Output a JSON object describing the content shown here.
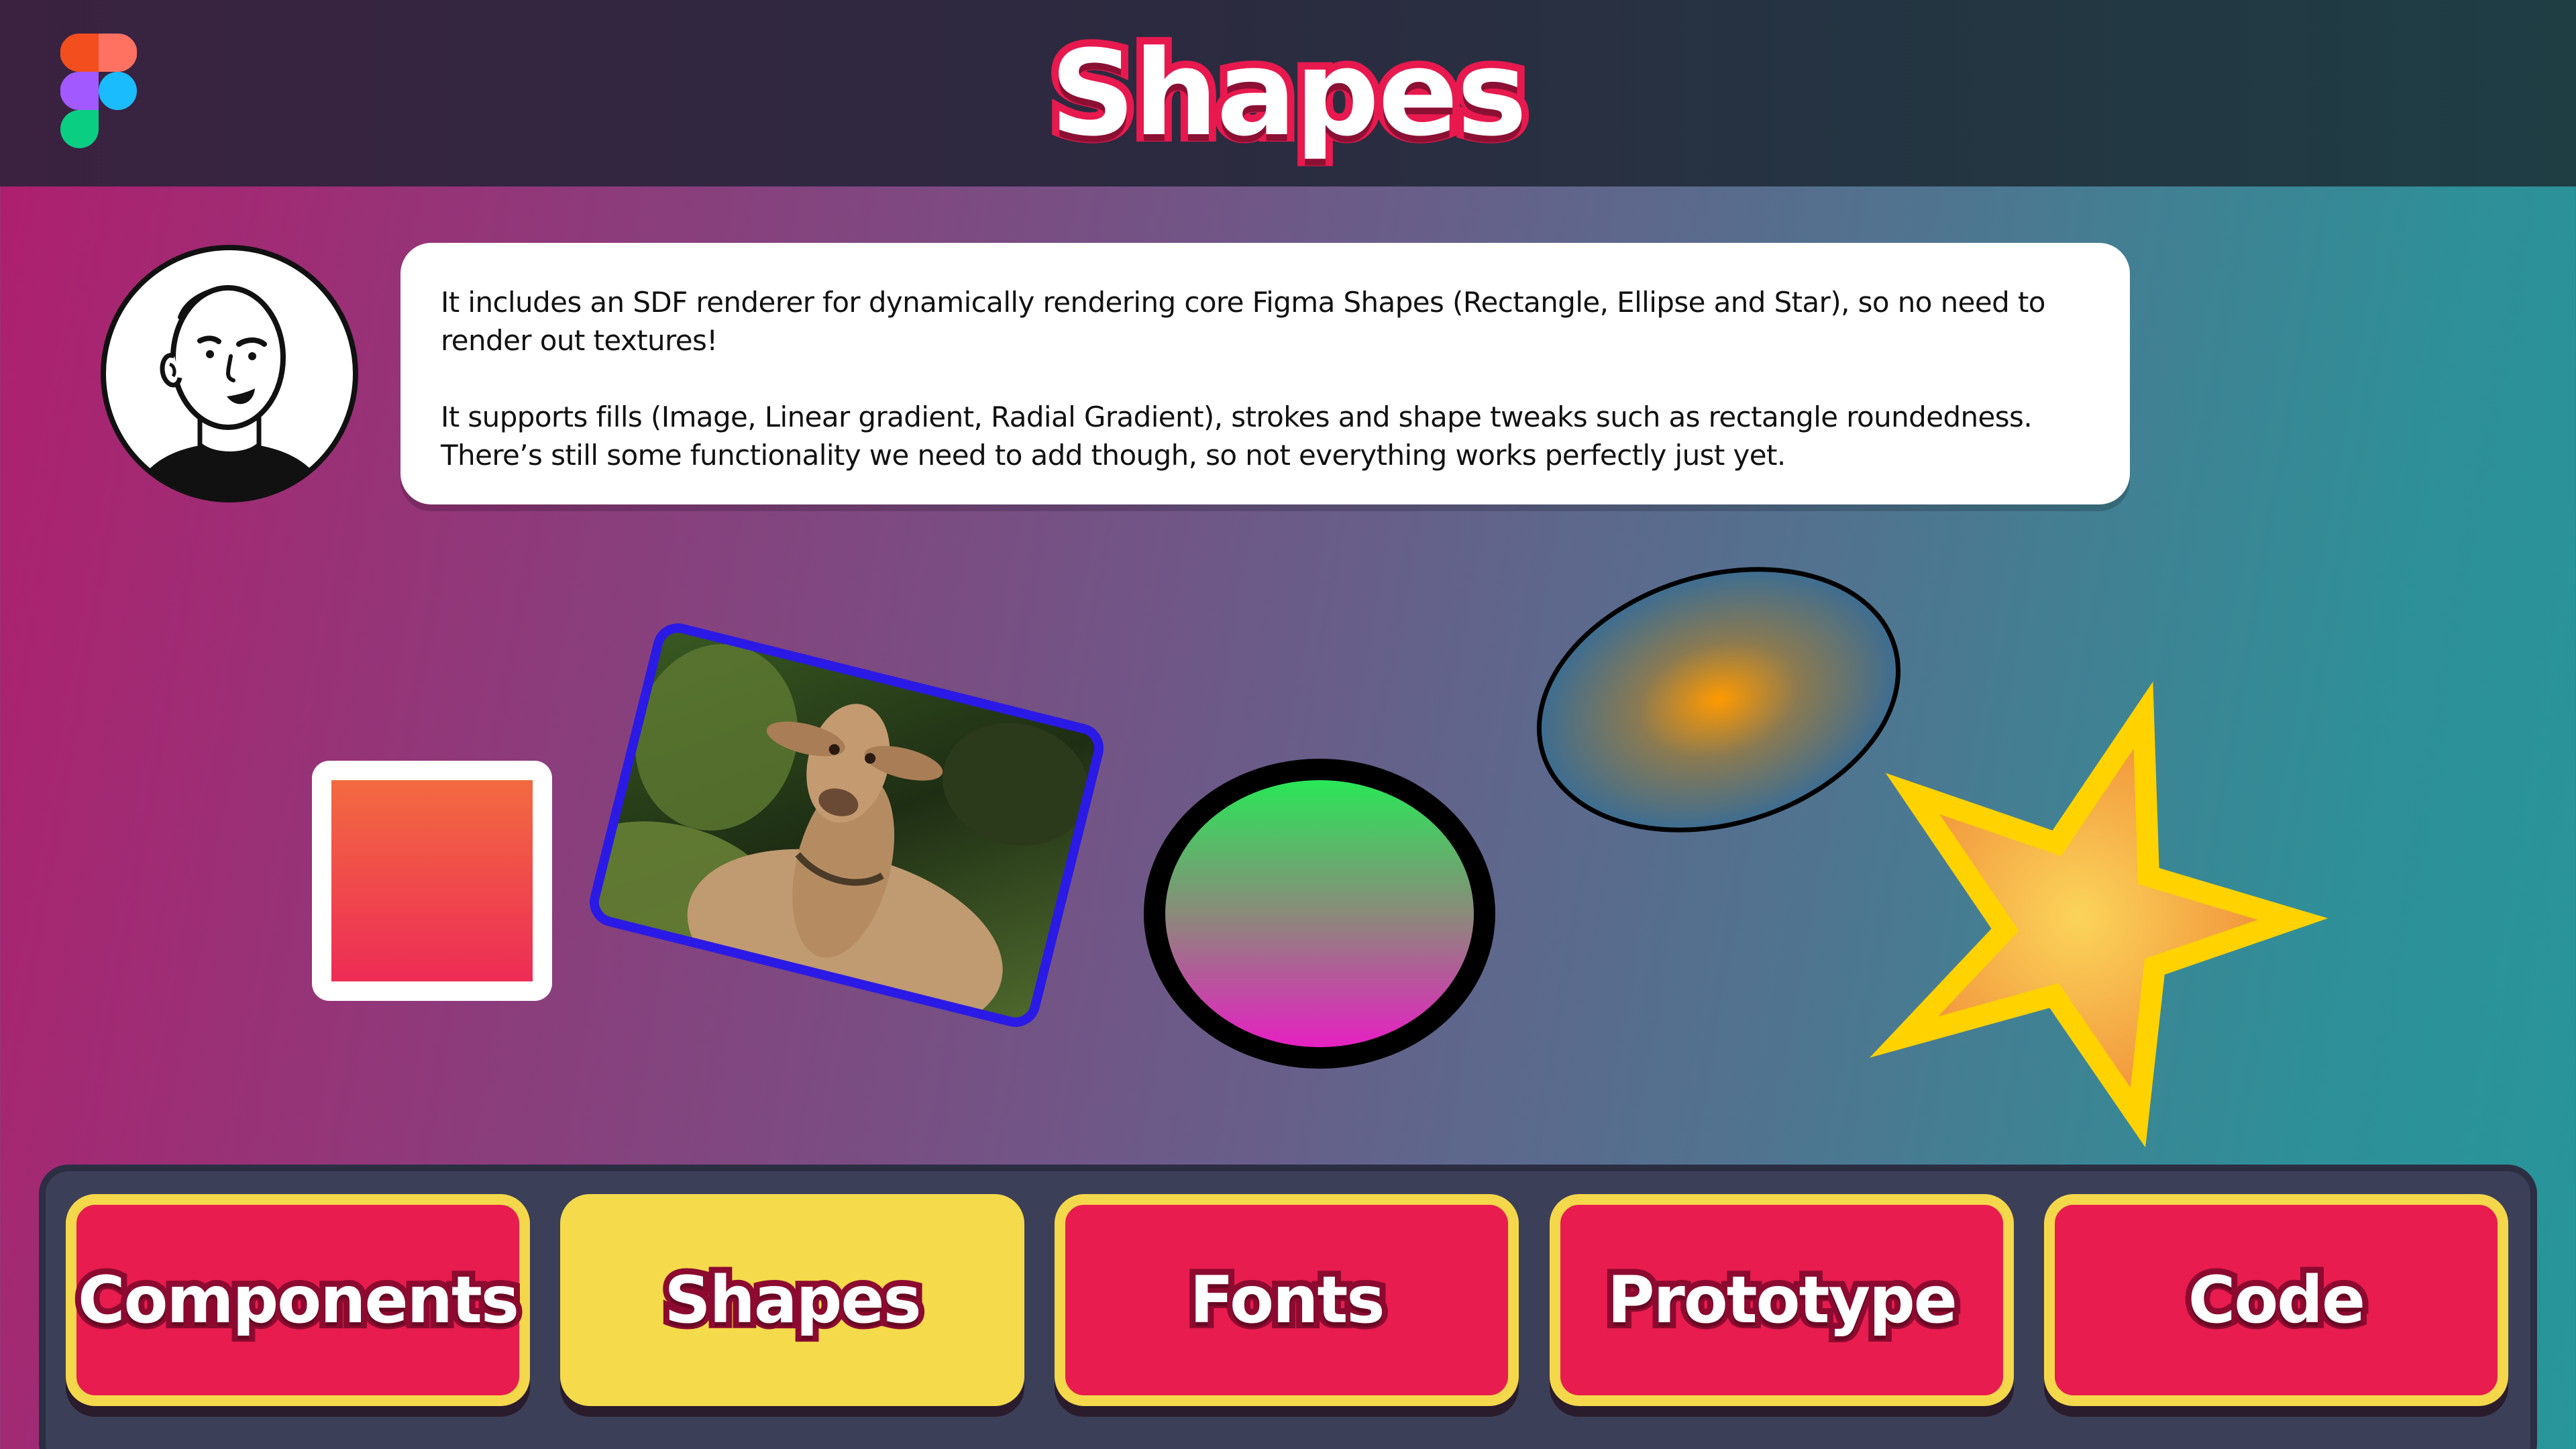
{
  "header": {
    "title": "Shapes",
    "logo_icon": "figma-logo-icon"
  },
  "avatar": {
    "icon": "presenter-avatar-icon"
  },
  "bubble": {
    "paragraph_1": "It includes an SDF renderer for dynamically rendering core Figma Shapes (Rectangle, Ellipse and Star), so no need to render out textures!",
    "paragraph_2": "It supports fills (Image, Linear gradient, Radial Gradient), strokes and shape tweaks such as rectangle roundedness. There’s still some functionality we need to add though, so not everything works perfectly just yet."
  },
  "shapes": [
    {
      "kind": "rectangle",
      "fill": "linear-gradient",
      "colors": [
        "#f26a40",
        "#ee2c56"
      ],
      "stroke": "#ffffff"
    },
    {
      "kind": "rectangle",
      "fill": "image",
      "image": "goat-photo",
      "stroke": "#2b19e6"
    },
    {
      "kind": "ellipse",
      "fill": "linear-gradient",
      "colors": [
        "#22ee55",
        "#8a8a7a",
        "#ee18c8"
      ],
      "stroke": "#000000"
    },
    {
      "kind": "ellipse",
      "fill": "radial-gradient",
      "colors": [
        "#ff9a00",
        "#3d6d92"
      ],
      "stroke": "#000000"
    },
    {
      "kind": "star",
      "fill": "radial-gradient",
      "colors": [
        "#fbd45a",
        "#f08a36"
      ],
      "stroke": "#ffd200"
    }
  ],
  "nav": {
    "items": [
      {
        "label": "Components",
        "active": false
      },
      {
        "label": "Shapes",
        "active": true
      },
      {
        "label": "Fonts",
        "active": false
      },
      {
        "label": "Prototype",
        "active": false
      },
      {
        "label": "Code",
        "active": false
      }
    ]
  },
  "colors": {
    "accent_red": "#e81c4e",
    "accent_yellow": "#f5d74c",
    "panel": "#3c3f58"
  }
}
